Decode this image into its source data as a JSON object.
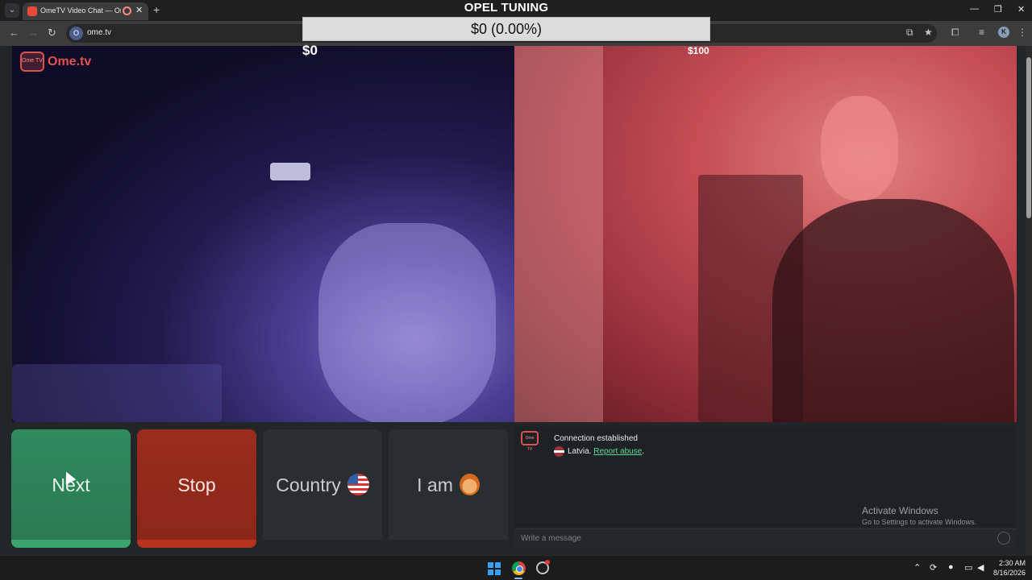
{
  "browser": {
    "tab_title": "OmeTV Video Chat — Ome",
    "url": "ome.tv",
    "site_badge": "O",
    "profile_initial": "K",
    "new_tab_symbol": "+",
    "close_symbol": "✕",
    "minimize_symbol": "—",
    "restore_symbol": "❐",
    "window_close_symbol": "✕",
    "back_symbol": "←",
    "forward_symbol": "→",
    "reload_symbol": "↻",
    "bookmark_symbol": "★",
    "search_tabs_symbol": "⌄"
  },
  "overlay": {
    "title": "OPEL TUNING",
    "progress_text": "$0 (0.00%)",
    "progress_fraction": 0.0,
    "goal_start": "$0",
    "goal_end": "$100"
  },
  "logo": {
    "text": "Ome.tv",
    "tv_text": "Ome TV"
  },
  "controls": {
    "next_label": "Next",
    "stop_label": "Stop",
    "country_label": "Country",
    "iam_label": "I am"
  },
  "chat": {
    "status": "Connection established",
    "country": "Latvia.",
    "report_link": "Report abuse",
    "report_suffix": ".",
    "input_placeholder": "Write a message"
  },
  "watermark": {
    "line1": "Activate Windows",
    "line2": "Go to Settings to activate Windows."
  },
  "taskbar": {
    "time": "2:30 AM",
    "date": "8/16/2026",
    "tray_chevron": "⌃"
  },
  "colors": {
    "next": "#2f8a5e",
    "stop": "#9b2c1c",
    "progress_fill": "#4caf50",
    "link": "#5fd79b"
  }
}
